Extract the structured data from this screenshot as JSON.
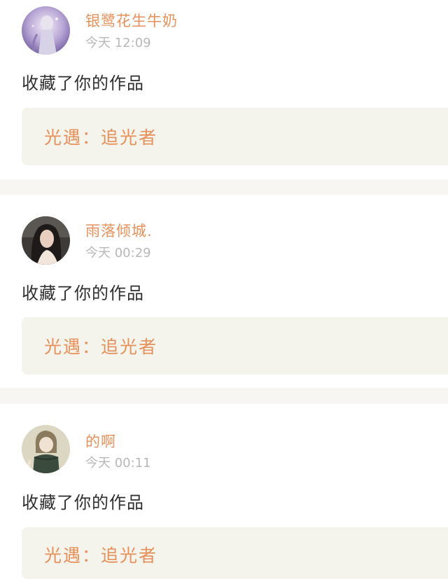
{
  "notifications": [
    {
      "username": "银鹭花生牛奶",
      "timestamp": "今天 12:09",
      "action": "收藏了你的作品",
      "work_title": "光遇：追光者"
    },
    {
      "username": "雨落倾城.",
      "timestamp": "今天 00:29",
      "action": "收藏了你的作品",
      "work_title": "光遇：追光者"
    },
    {
      "username": "的啊",
      "timestamp": "今天 00:11",
      "action": "收藏了你的作品",
      "work_title": "光遇：追光者"
    }
  ],
  "colors": {
    "accent": "#e8905a",
    "timestamp": "#b8b8b8",
    "body_text": "#2e2e2e",
    "work_box": "#f4f3ec",
    "separator": "#f7f6f3"
  }
}
